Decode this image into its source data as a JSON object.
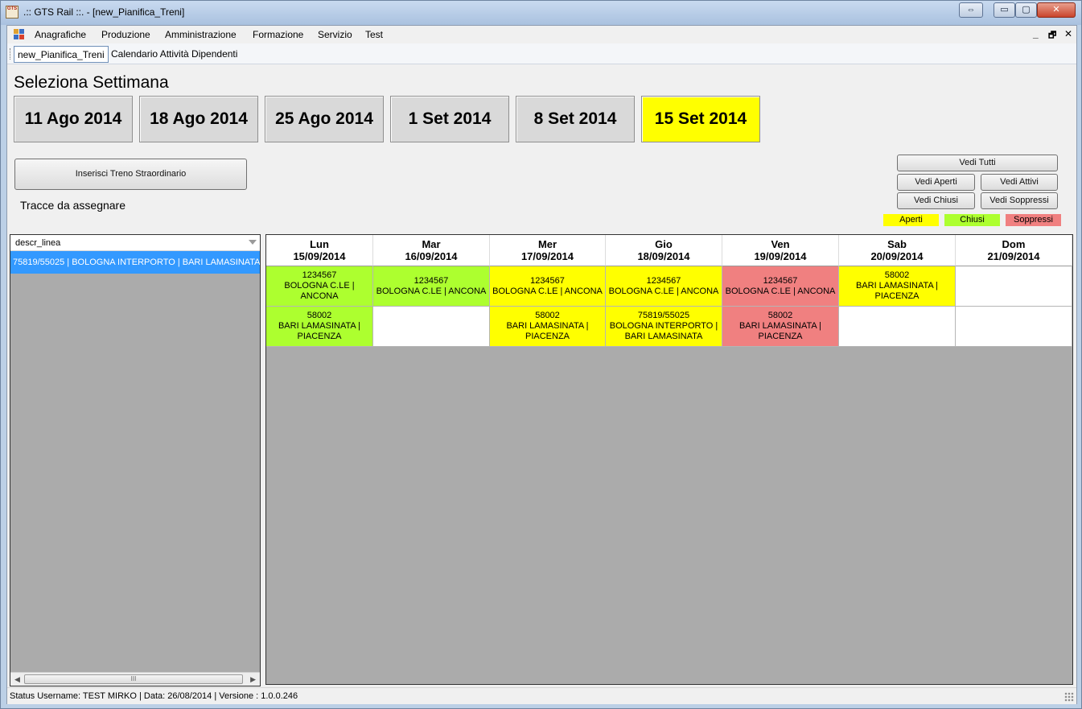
{
  "window": {
    "title": ".:: GTS Rail ::. - [new_Pianifica_Treni]",
    "app_icon_text": "GTS",
    "buttons": {
      "extra": "⇔",
      "minimize": "▭",
      "maximize": "▢",
      "close": "✕"
    }
  },
  "menu": {
    "items": [
      "Anagrafiche",
      "Produzione",
      "Amministrazione",
      "Formazione",
      "Servizio",
      "Test"
    ],
    "mdi_controls": [
      "_",
      "🗗",
      "✕"
    ]
  },
  "tabs": [
    {
      "label": "new_Pianifica_Treni",
      "active": true
    },
    {
      "label": "Calendario Attività Dipendenti",
      "active": false
    }
  ],
  "heading": "Seleziona Settimana",
  "weeks": [
    {
      "label": "11 Ago 2014",
      "selected": false
    },
    {
      "label": "18 Ago 2014",
      "selected": false
    },
    {
      "label": "25 Ago 2014",
      "selected": false
    },
    {
      "label": "1 Set 2014",
      "selected": false
    },
    {
      "label": "8 Set 2014",
      "selected": false
    },
    {
      "label": "15 Set 2014",
      "selected": true
    }
  ],
  "actions": {
    "insert_train": "Inserisci Treno Straordinario",
    "tracce_label": "Tracce da assegnare",
    "vedi_tutti": "Vedi Tutti",
    "vedi_aperti": "Vedi Aperti",
    "vedi_attivi": "Vedi Attivi",
    "vedi_chiusi": "Vedi Chiusi",
    "vedi_soppressi": "Vedi Soppressi"
  },
  "legend": [
    {
      "label": "Aperti",
      "color": "#ffff00"
    },
    {
      "label": "Chiusi",
      "color": "#adff2f"
    },
    {
      "label": "Soppressi",
      "color": "#f08080"
    }
  ],
  "left_list": {
    "column_header": "descr_linea",
    "rows": [
      "75819/55025 | BOLOGNA INTERPORTO | BARI LAMASINATA"
    ],
    "scroll_thumb": "III"
  },
  "calendar": {
    "days": [
      {
        "name": "Lun",
        "date": "15/09/2014"
      },
      {
        "name": "Mar",
        "date": "16/09/2014"
      },
      {
        "name": "Mer",
        "date": "17/09/2014"
      },
      {
        "name": "Gio",
        "date": "18/09/2014"
      },
      {
        "name": "Ven",
        "date": "19/09/2014"
      },
      {
        "name": "Sab",
        "date": "20/09/2014"
      },
      {
        "name": "Dom",
        "date": "21/09/2014"
      }
    ],
    "rows": [
      [
        {
          "code": "1234567",
          "route": "BOLOGNA C.LE | ANCONA",
          "status": "chiuso"
        },
        {
          "code": "1234567",
          "route": "BOLOGNA C.LE | ANCONA",
          "status": "chiuso"
        },
        {
          "code": "1234567",
          "route": "BOLOGNA C.LE | ANCONA",
          "status": "aperto"
        },
        {
          "code": "1234567",
          "route": "BOLOGNA C.LE | ANCONA",
          "status": "aperto"
        },
        {
          "code": "1234567",
          "route": "BOLOGNA C.LE | ANCONA",
          "status": "soppresso"
        },
        {
          "code": "58002",
          "route": "BARI LAMASINATA | PIACENZA",
          "status": "aperto"
        },
        {
          "code": "",
          "route": "",
          "status": "vuoto"
        }
      ],
      [
        {
          "code": "58002",
          "route": "BARI LAMASINATA | PIACENZA",
          "status": "chiuso"
        },
        {
          "code": "",
          "route": "",
          "status": "vuoto"
        },
        {
          "code": "58002",
          "route": "BARI LAMASINATA | PIACENZA",
          "status": "aperto"
        },
        {
          "code": "75819/55025",
          "route": "BOLOGNA INTERPORTO | BARI LAMASINATA",
          "status": "aperto"
        },
        {
          "code": "58002",
          "route": "BARI LAMASINATA | PIACENZA",
          "status": "soppresso"
        },
        {
          "code": "",
          "route": "",
          "status": "vuoto"
        },
        {
          "code": "",
          "route": "",
          "status": "vuoto"
        }
      ]
    ],
    "status_colors": {
      "aperto": "#ffff00",
      "chiuso": "#adff2f",
      "soppresso": "#f08080",
      "vuoto": "#ffffff"
    }
  },
  "statusbar": {
    "text": "Status  Username:   TEST MIRKO   |    Data:  26/08/2014   | Versione :   1.0.0.246"
  }
}
